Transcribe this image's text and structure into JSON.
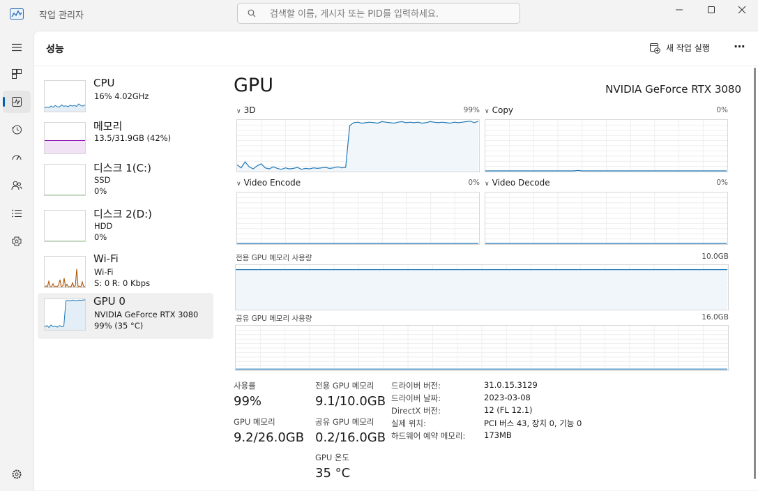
{
  "window": {
    "title": "작업 관리자",
    "search_placeholder": "검색할 이름, 게시자 또는 PID를 입력하세요."
  },
  "nav": [
    {
      "id": "menu",
      "icon": "hamburger-icon"
    },
    {
      "id": "processes",
      "icon": "processes-icon"
    },
    {
      "id": "performance",
      "icon": "performance-icon",
      "active": true
    },
    {
      "id": "app-history",
      "icon": "history-icon"
    },
    {
      "id": "startup",
      "icon": "startup-icon"
    },
    {
      "id": "users",
      "icon": "users-icon"
    },
    {
      "id": "details",
      "icon": "details-icon"
    },
    {
      "id": "services",
      "icon": "services-icon"
    },
    {
      "id": "settings",
      "icon": "settings-icon"
    }
  ],
  "header": {
    "title": "성능",
    "run_task": "새 작업 실행",
    "more": "⋯"
  },
  "devices": [
    {
      "name": "CPU",
      "line2": "16% 4.02GHz",
      "line3": "",
      "color": "#1f77b4"
    },
    {
      "name": "메모리",
      "line2": "13.5/31.9GB (42%)",
      "line3": "",
      "color": "#8b12ae"
    },
    {
      "name": "디스크 1(C:)",
      "line2": "SSD",
      "line3": "0%",
      "color": "#4aa02c"
    },
    {
      "name": "디스크 2(D:)",
      "line2": "HDD",
      "line3": "0%",
      "color": "#4aa02c"
    },
    {
      "name": "Wi-Fi",
      "line2": "Wi-Fi",
      "line3": "S: 0 R: 0 Kbps",
      "color": "#a74f01"
    },
    {
      "name": "GPU 0",
      "line2": "NVIDIA GeForce RTX 3080",
      "line3": "99% (35 °C)",
      "color": "#1f77b4",
      "selected": true
    }
  ],
  "gpu": {
    "title": "GPU",
    "model": "NVIDIA GeForce RTX 3080",
    "engines": [
      {
        "label": "3D",
        "percent": "99%"
      },
      {
        "label": "Copy",
        "percent": "0%"
      },
      {
        "label": "Video Encode",
        "percent": "0%"
      },
      {
        "label": "Video Decode",
        "percent": "0%"
      }
    ],
    "dedicated_label": "전용 GPU 메모리 사용량",
    "dedicated_max": "10.0GB",
    "shared_label": "공유 GPU 메모리 사용량",
    "shared_max": "16.0GB"
  },
  "chart_data": [
    {
      "type": "line",
      "title": "3D",
      "ylim": [
        0,
        100
      ],
      "x": [
        0,
        1,
        2,
        3,
        4,
        5,
        6,
        7,
        8,
        9,
        10,
        11,
        12,
        13,
        14,
        15,
        16,
        17,
        18,
        19,
        20,
        21,
        22,
        23,
        24,
        25,
        26,
        27,
        28,
        29,
        30,
        31,
        32,
        33,
        34,
        35,
        36,
        37,
        38,
        39,
        40,
        41,
        42,
        43,
        44,
        45,
        46,
        47,
        48,
        49,
        50,
        51,
        52,
        53,
        54,
        55,
        56,
        57,
        58,
        59,
        60
      ],
      "series": [
        {
          "values": [
            12,
            6,
            18,
            8,
            4,
            10,
            14,
            6,
            4,
            8,
            5,
            3,
            6,
            4,
            5,
            7,
            3,
            5,
            4,
            6,
            5,
            6,
            7,
            5,
            6,
            8,
            6,
            7,
            90,
            96,
            97,
            95,
            96,
            97,
            96,
            95,
            98,
            97,
            96,
            95,
            97,
            98,
            96,
            97,
            96,
            97,
            95,
            96,
            98,
            97,
            96,
            97,
            96,
            95,
            97,
            96,
            97,
            98,
            99,
            96,
            99
          ]
        }
      ]
    },
    {
      "type": "line",
      "title": "Copy",
      "ylim": [
        0,
        100
      ],
      "series": [
        {
          "values": [
            0,
            0,
            0,
            0,
            0,
            0,
            0,
            0,
            0,
            0,
            0,
            0,
            0,
            0,
            0,
            0,
            0,
            0,
            0,
            0,
            0,
            0,
            0,
            1,
            0,
            0,
            0,
            0,
            0,
            0,
            0,
            0,
            0,
            0,
            0,
            0,
            0,
            0,
            0,
            0,
            0,
            0,
            0,
            0,
            0,
            0,
            0,
            0,
            0,
            0,
            0,
            0,
            0,
            0,
            0,
            0,
            0,
            0,
            0,
            0,
            0
          ]
        }
      ]
    },
    {
      "type": "line",
      "title": "Video Encode",
      "ylim": [
        0,
        100
      ],
      "series": [
        {
          "values": [
            0,
            0,
            0,
            0,
            0,
            0,
            0,
            0,
            0,
            0,
            0,
            0,
            0,
            0,
            0,
            0,
            0,
            0,
            0,
            0,
            0,
            0,
            0,
            0,
            0,
            0,
            0,
            0,
            0,
            0,
            0,
            0,
            0,
            0,
            0,
            0,
            0,
            0,
            0,
            0,
            0,
            0,
            0,
            0,
            0,
            0,
            0,
            0,
            0,
            0,
            0,
            0,
            0,
            0,
            0,
            0,
            0,
            0,
            0,
            0,
            0
          ]
        }
      ]
    },
    {
      "type": "line",
      "title": "Video Decode",
      "ylim": [
        0,
        100
      ],
      "series": [
        {
          "values": [
            0,
            0,
            0,
            0,
            0,
            0,
            0,
            0,
            0,
            0,
            0,
            0,
            0,
            0,
            0,
            0,
            0,
            0,
            0,
            0,
            0,
            0,
            0,
            0,
            0,
            0,
            0,
            0,
            0,
            0,
            0,
            0,
            0,
            0,
            0,
            0,
            0,
            0,
            0,
            0,
            0,
            0,
            0,
            0,
            0,
            0,
            0,
            0,
            0,
            0,
            0,
            0,
            0,
            0,
            0,
            0,
            0,
            0,
            0,
            0,
            0
          ]
        }
      ]
    },
    {
      "type": "area",
      "title": "전용 GPU 메모리 사용량",
      "ylim": [
        0,
        10
      ],
      "series": [
        {
          "values": [
            9.1,
            9.1,
            9.1,
            9.1,
            9.1,
            9.1,
            9.1,
            9.1,
            9.1,
            9.1,
            9.1,
            9.1,
            9.1,
            9.1,
            9.1,
            9.1,
            9.1,
            9.1,
            9.1,
            9.1,
            9.1,
            9.1,
            9.1,
            9.1,
            9.1,
            9.1,
            9.1,
            9.1,
            9.1,
            9.1,
            9.1,
            9.1,
            9.1,
            9.1,
            9.1,
            9.1,
            9.1,
            9.1,
            9.1,
            9.1,
            9.1,
            9.1,
            9.1,
            9.1,
            9.1,
            9.1,
            9.1,
            9.1,
            9.1,
            9.1,
            9.1,
            9.1,
            9.1,
            9.1,
            9.1,
            9.1,
            9.1,
            9.1,
            9.1,
            9.1,
            9.1
          ]
        }
      ]
    },
    {
      "type": "area",
      "title": "공유 GPU 메모리 사용량",
      "ylim": [
        0,
        16
      ],
      "series": [
        {
          "values": [
            0.2,
            0.2,
            0.2,
            0.2,
            0.2,
            0.2,
            0.2,
            0.2,
            0.2,
            0.2,
            0.2,
            0.2,
            0.2,
            0.2,
            0.2,
            0.2,
            0.2,
            0.2,
            0.2,
            0.2,
            0.2,
            0.2,
            0.2,
            0.2,
            0.2,
            0.2,
            0.2,
            0.2,
            0.2,
            0.2,
            0.2,
            0.2,
            0.2,
            0.2,
            0.2,
            0.2,
            0.2,
            0.2,
            0.2,
            0.2,
            0.2,
            0.2,
            0.2,
            0.2,
            0.2,
            0.2,
            0.2,
            0.2,
            0.2,
            0.2,
            0.2,
            0.2,
            0.2,
            0.2,
            0.2,
            0.2,
            0.2,
            0.2,
            0.2,
            0.2,
            0.2
          ]
        }
      ]
    }
  ],
  "stats": {
    "usage_label": "사용률",
    "usage_value": "99%",
    "gpu_mem_label": "GPU 메모리",
    "gpu_mem_value": "9.2/26.0GB",
    "dedicated_label": "전용 GPU 메모리",
    "dedicated_value": "9.1/10.0GB",
    "shared_label": "공유 GPU 메모리",
    "shared_value": "0.2/16.0GB",
    "temp_label": "GPU 온도",
    "temp_value": "35 °C"
  },
  "info": [
    {
      "key": "드라이버 버전:",
      "value": "31.0.15.3129"
    },
    {
      "key": "드라이버 날짜:",
      "value": "2023-03-08"
    },
    {
      "key": "DirectX 버전:",
      "value": "12 (FL 12.1)"
    },
    {
      "key": "실제 위치:",
      "value": "PCI 버스 43, 장치 0, 기능 0"
    },
    {
      "key": "하드웨어 예약 메모리:",
      "value": "173MB"
    }
  ],
  "colors": {
    "gpu": "#1f77b4",
    "gpu_fill": "#f1f6fb",
    "grid": "#eeeeee",
    "accent": "#005fb8"
  }
}
